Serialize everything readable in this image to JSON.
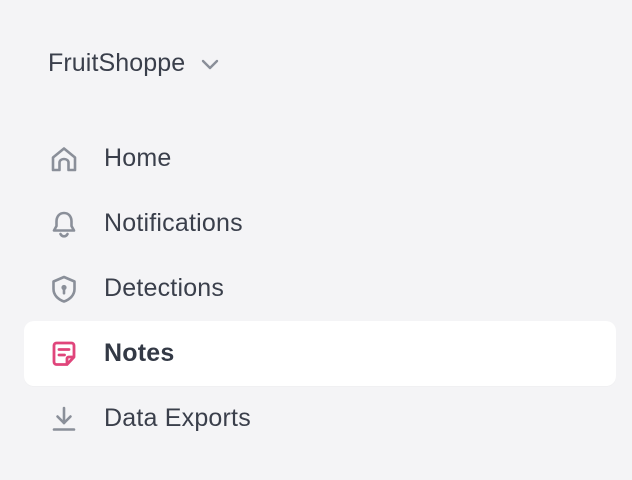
{
  "workspace": {
    "name": "FruitShoppe",
    "dropdown_icon": "chevron-down-icon"
  },
  "nav": {
    "items": [
      {
        "label": "Home",
        "icon": "home-icon",
        "active": false
      },
      {
        "label": "Notifications",
        "icon": "bell-icon",
        "active": false
      },
      {
        "label": "Detections",
        "icon": "shield-icon",
        "active": false
      },
      {
        "label": "Notes",
        "icon": "notes-icon",
        "active": true
      },
      {
        "label": "Data Exports",
        "icon": "download-icon",
        "active": false
      }
    ]
  },
  "colors": {
    "background": "#f4f4f6",
    "active_item_bg": "#ffffff",
    "icon_gray": "#8a8f99",
    "accent_pink": "#e0457b",
    "text": "#3a3f4b"
  }
}
